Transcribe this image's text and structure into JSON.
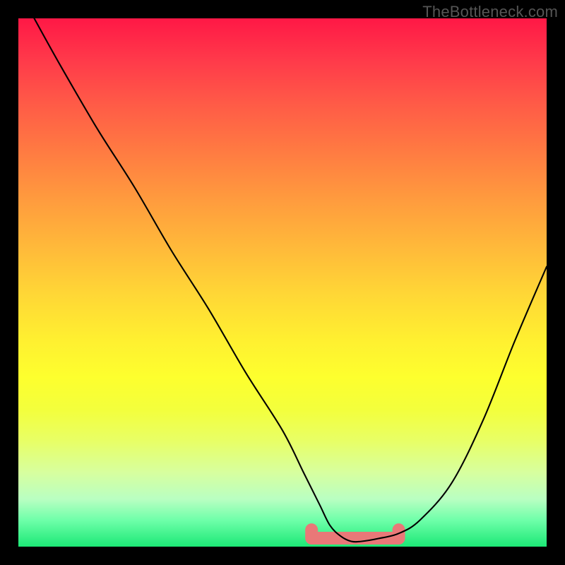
{
  "attribution": "TheBottleneck.com",
  "chart_data": {
    "type": "line",
    "title": "",
    "xlabel": "",
    "ylabel": "",
    "xlim": [
      0,
      100
    ],
    "ylim": [
      0,
      100
    ],
    "grid": false,
    "series": [
      {
        "name": "bottleneck-curve",
        "color": "#000000",
        "x": [
          3,
          8,
          15,
          22,
          29,
          36,
          43,
          50,
          54,
          57,
          59,
          61,
          63,
          65,
          68,
          72,
          76,
          82,
          88,
          94,
          100
        ],
        "values": [
          100,
          91,
          79,
          68,
          56,
          45,
          33,
          22,
          14,
          8,
          4,
          2,
          1,
          1,
          1.5,
          2.5,
          5,
          12,
          24,
          39,
          53
        ]
      }
    ],
    "highlight_band": {
      "name": "optimal-zone",
      "color": "#e97878",
      "x_range": [
        55.5,
        72
      ],
      "y": 1.6
    }
  }
}
